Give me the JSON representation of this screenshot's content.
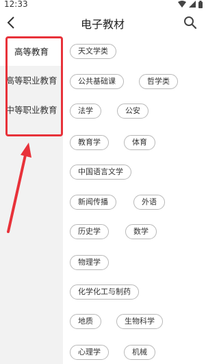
{
  "status_bar": {
    "time": "12:33"
  },
  "header": {
    "title": "电子教材"
  },
  "sidebar": {
    "items": [
      {
        "label": "高等教育",
        "active": true
      },
      {
        "label": "高等职业教育",
        "active": false
      },
      {
        "label": "中等职业教育",
        "active": false
      }
    ]
  },
  "subjects": {
    "tags": [
      "天文学类",
      "公共基础课",
      "哲学类",
      "法学",
      "公安",
      "教育学",
      "体育",
      "中国语言文学",
      "新闻传播",
      "外语",
      "历史学",
      "数学",
      "物理学",
      "化学化工与制药",
      "地质",
      "生物科学",
      "心理学",
      "机械"
    ]
  },
  "colors": {
    "highlight": "#e8323a",
    "sidebar_bg": "#f2f2f2",
    "tag_border": "#b8b8b8"
  },
  "icons": [
    "back-arrow-icon",
    "search-icon",
    "wifi-icon",
    "signal-icon",
    "battery-icon"
  ]
}
